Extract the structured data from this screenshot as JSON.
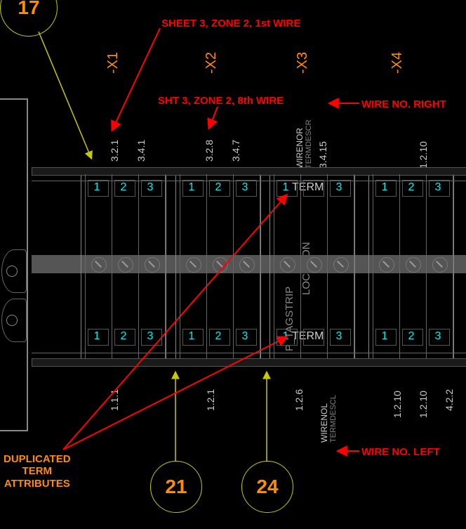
{
  "annotations": {
    "top_note": "SHEET 3, ZONE 2, 1st WIRE",
    "mid_note": "SHT 3, ZONE 2, 8th WIRE",
    "right_note_top": "WIRE NO. RIGHT",
    "right_note_bot": "WIRE NO. LEFT",
    "dup_note": "DUPLICATED\nTERM\nATTRIBUTES"
  },
  "circles": {
    "c17": "17",
    "c21": "21",
    "c24": "24"
  },
  "groups": {
    "g1": {
      "label": "-X1",
      "top_wires": [
        "3.2.1",
        "3.4.1",
        ""
      ],
      "bot_wires": [
        "1.1.1",
        "",
        ""
      ]
    },
    "g2": {
      "label": "-X2",
      "top_wires": [
        "3.2.8",
        "3.4.7",
        ""
      ],
      "bot_wires": [
        "1.2.1",
        "",
        ""
      ]
    },
    "g3": {
      "label": "-X3",
      "top_wires": [
        "WIRENOR",
        "3.4.15",
        ""
      ],
      "bot_wires": [
        "1.2.6",
        "",
        ""
      ],
      "special": true
    },
    "g4": {
      "label": "-X4",
      "top_wires": [
        "",
        "1.2.10",
        ""
      ],
      "bot_wires": [
        "1.2.10",
        "1.2.10",
        "4.2.2"
      ]
    }
  },
  "term_nums": [
    "1",
    "2",
    "3"
  ],
  "term_text": "TERM",
  "attr_texts": {
    "r": "TERMDESCR",
    "l": "TERMDESCL",
    "wl": "WIRENOL"
  },
  "vert_gray": {
    "p": "P_TAGSTRIP",
    "l": "LOCATION"
  }
}
